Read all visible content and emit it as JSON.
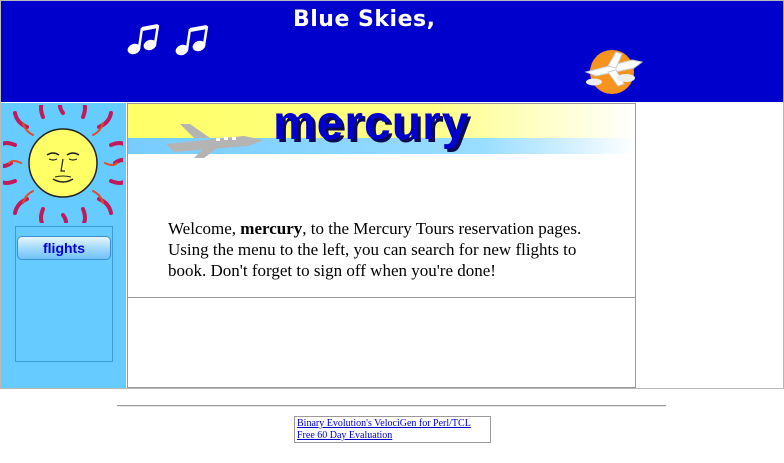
{
  "banner": {
    "title": "Blue Skies,",
    "icons": [
      "music-notes-icon",
      "airplane-sun-logo-icon"
    ]
  },
  "sidebar": {
    "logo": "sun-face-icon",
    "nav": [
      {
        "label": "flights"
      }
    ]
  },
  "content": {
    "header_word": "mercury",
    "welcome_prefix": "Welcome, ",
    "welcome_user": "mercury",
    "welcome_suffix": ", to the Mercury Tours reservation pages. Using the menu to the left, you can search for new flights to book. Don't forget to sign off when you're done!"
  },
  "footer": {
    "ad_line1": "Binary Evolution's VelociGen for Perl/TCL",
    "ad_line2": "Free 60 Day Evaluation"
  },
  "colors": {
    "banner_bg": "#0000cc",
    "sidebar_bg": "#66ccff",
    "link": "#0000cc"
  }
}
